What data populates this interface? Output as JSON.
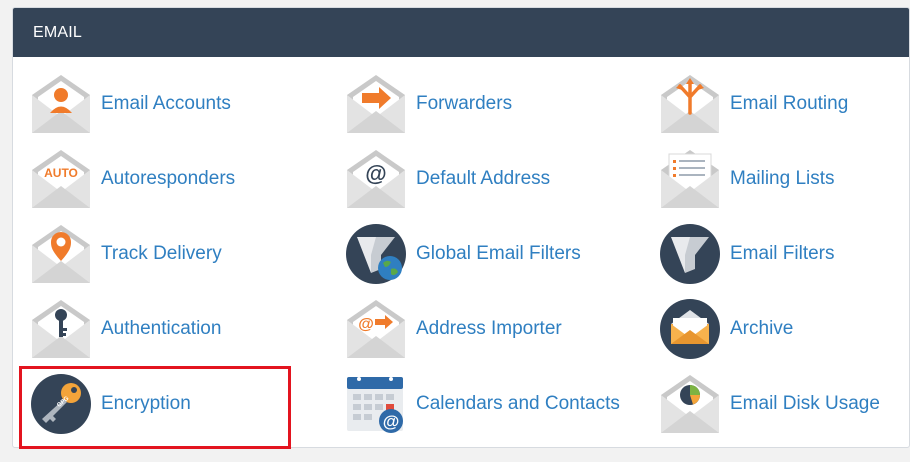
{
  "section": {
    "title": "EMAIL"
  },
  "items": [
    {
      "label": "Email Accounts",
      "icon": "email-accounts-icon"
    },
    {
      "label": "Forwarders",
      "icon": "forwarders-icon"
    },
    {
      "label": "Email Routing",
      "icon": "email-routing-icon"
    },
    {
      "label": "Autoresponders",
      "icon": "autoresponders-icon",
      "badge": "AUTO"
    },
    {
      "label": "Default Address",
      "icon": "default-address-icon",
      "badge": "@"
    },
    {
      "label": "Mailing Lists",
      "icon": "mailing-lists-icon"
    },
    {
      "label": "Track Delivery",
      "icon": "track-delivery-icon"
    },
    {
      "label": "Global Email Filters",
      "icon": "global-email-filters-icon"
    },
    {
      "label": "Email Filters",
      "icon": "email-filters-icon"
    },
    {
      "label": "Authentication",
      "icon": "authentication-icon"
    },
    {
      "label": "Address Importer",
      "icon": "address-importer-icon",
      "badge": "@"
    },
    {
      "label": "Archive",
      "icon": "archive-icon"
    },
    {
      "label": "Encryption",
      "icon": "encryption-icon",
      "badge": "GPG"
    },
    {
      "label": "Calendars and Contacts",
      "icon": "calendars-and-contacts-icon",
      "badge": "@"
    },
    {
      "label": "Email Disk Usage",
      "icon": "email-disk-usage-icon"
    }
  ],
  "colors": {
    "header_bg": "#344457",
    "link": "#2f7fc1",
    "accent_orange": "#f07b2b",
    "icon_dark": "#344457",
    "highlight": "#e3141f"
  }
}
